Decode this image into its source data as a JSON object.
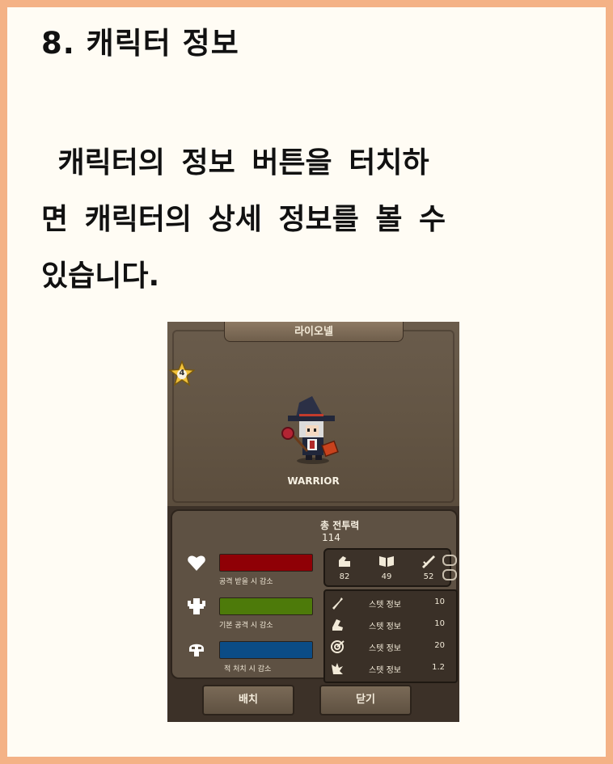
{
  "heading": "8. 캐릭터 정보",
  "paragraph": {
    "line1": " 캐릭터의 정보 버튼을 터치하",
    "line2": "면 캐릭터의 상세 정보를 볼 수",
    "line3": "있습니다."
  },
  "game": {
    "title": "라이오넬",
    "level": "4",
    "class_name": "WARRIOR",
    "total_power_label": "총 전투력",
    "total_power_value": "114",
    "attributes": [
      {
        "icon": "heart-icon",
        "color": "#8f0006",
        "caption": "공격 받을 시 감소"
      },
      {
        "icon": "muscle-icon",
        "color": "#4d7a0a",
        "caption": "기본 공격 시 감소"
      },
      {
        "icon": "skull-icon",
        "color": "#0b4c86",
        "caption": "적 처치 시 감소"
      }
    ],
    "stats": [
      {
        "icon": "arm-strength-icon",
        "value": "82"
      },
      {
        "icon": "book-icon",
        "value": "49"
      },
      {
        "icon": "dagger-icon",
        "value": "52"
      }
    ],
    "details": [
      {
        "icon": "sword-icon",
        "label": "스텟 정보",
        "value": "10"
      },
      {
        "icon": "boot-icon",
        "label": "스텟 정보",
        "value": "10"
      },
      {
        "icon": "target-icon",
        "label": "스텟 정보",
        "value": "20"
      },
      {
        "icon": "critical-icon",
        "label": "스텟 정보",
        "value": "1.2"
      }
    ],
    "buttons": {
      "place": "배치",
      "close": "닫기"
    }
  }
}
